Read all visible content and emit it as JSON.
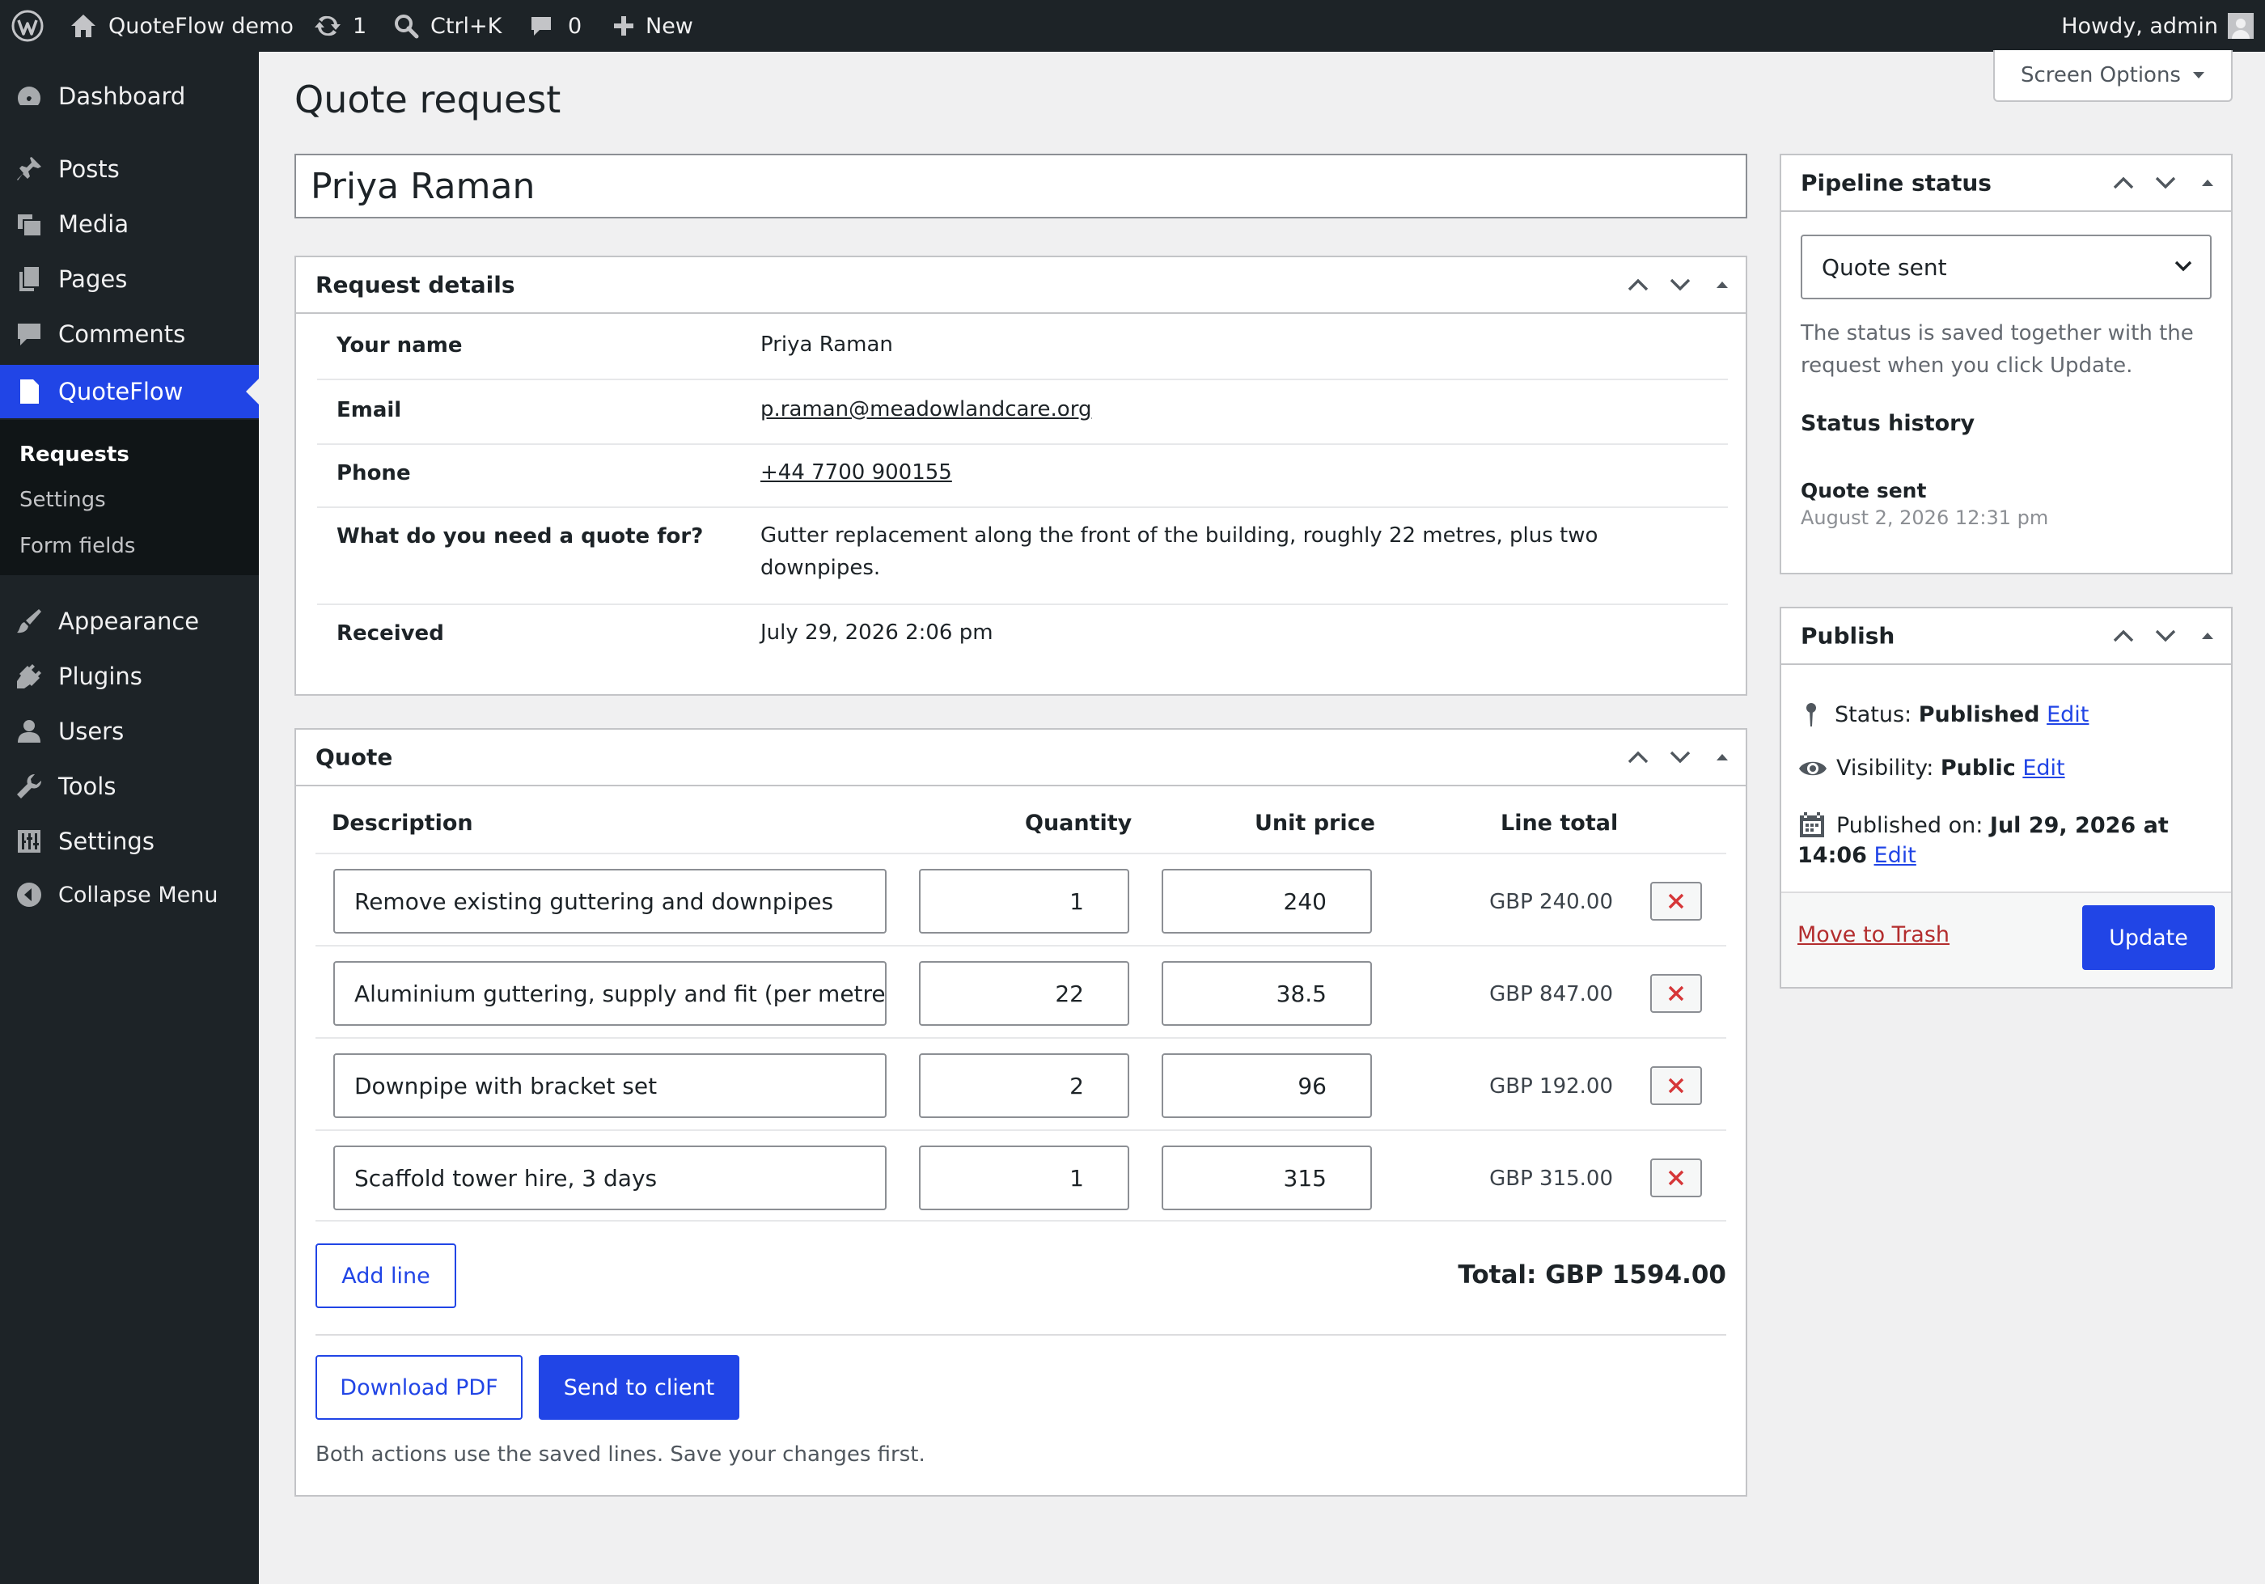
{
  "adminbar": {
    "site_name": "QuoteFlow demo",
    "updates_count": "1",
    "search_shortcut": "Ctrl+K",
    "comments_count": "0",
    "new_label": "New",
    "howdy": "Howdy, admin"
  },
  "sidebar": {
    "items": [
      {
        "label": "Dashboard",
        "icon": "dashboard-icon"
      },
      {
        "label": "Posts",
        "icon": "pin-icon"
      },
      {
        "label": "Media",
        "icon": "media-icon"
      },
      {
        "label": "Pages",
        "icon": "pages-icon"
      },
      {
        "label": "Comments",
        "icon": "comment-icon"
      },
      {
        "label": "QuoteFlow",
        "icon": "document-icon"
      },
      {
        "label": "Appearance",
        "icon": "brush-icon"
      },
      {
        "label": "Plugins",
        "icon": "plug-icon"
      },
      {
        "label": "Users",
        "icon": "user-icon"
      },
      {
        "label": "Tools",
        "icon": "wrench-icon"
      },
      {
        "label": "Settings",
        "icon": "sliders-icon"
      },
      {
        "label": "Collapse Menu",
        "icon": "collapse-icon"
      }
    ],
    "submenu": [
      "Requests",
      "Settings",
      "Form fields"
    ]
  },
  "screen_options_label": "Screen Options",
  "page_title": "Quote request",
  "post_title": "Priya Raman",
  "request_details": {
    "title": "Request details",
    "rows": [
      {
        "label": "Your name",
        "value": "Priya Raman"
      },
      {
        "label": "Email",
        "value": "p.raman@meadowlandcare.org"
      },
      {
        "label": "Phone",
        "value": "+44 7700 900155"
      },
      {
        "label": "What do you need a quote for?",
        "value": "Gutter replacement along the front of the building, roughly 22 metres, plus two downpipes."
      },
      {
        "label": "Received",
        "value": "July 29, 2026 2:06 pm"
      }
    ]
  },
  "quote": {
    "title": "Quote",
    "headers": {
      "description": "Description",
      "quantity": "Quantity",
      "unit_price": "Unit price",
      "line_total": "Line total"
    },
    "lines": [
      {
        "description": "Remove existing guttering and downpipes",
        "quantity": "1",
        "unit_price": "240",
        "line_total": "GBP 240.00"
      },
      {
        "description": "Aluminium guttering, supply and fit (per metre)",
        "quantity": "22",
        "unit_price": "38.5",
        "line_total": "GBP 847.00"
      },
      {
        "description": "Downpipe with bracket set",
        "quantity": "2",
        "unit_price": "96",
        "line_total": "GBP 192.00"
      },
      {
        "description": "Scaffold tower hire, 3 days",
        "quantity": "1",
        "unit_price": "315",
        "line_total": "GBP 315.00"
      }
    ],
    "add_line_label": "Add line",
    "total": "Total: GBP 1594.00",
    "download_pdf_label": "Download PDF",
    "send_label": "Send to client",
    "note": "Both actions use the saved lines. Save your changes first."
  },
  "pipeline": {
    "title": "Pipeline status",
    "selected": "Quote sent",
    "help": "The status is saved together with the request when you click Update.",
    "history_title": "Status history",
    "history": [
      {
        "status": "Quote sent",
        "date": "August 2, 2026 12:31 pm"
      }
    ]
  },
  "publish": {
    "title": "Publish",
    "status_label": "Status:",
    "status_value": "Published",
    "visibility_label": "Visibility:",
    "visibility_value": "Public",
    "published_label": "Published on:",
    "published_value_1": "Jul 29, 2026 at",
    "published_value_2": "14:06",
    "edit_label": "Edit",
    "trash_label": "Move to Trash",
    "update_label": "Update"
  },
  "colors": {
    "accent": "#2145e6",
    "admin_bar": "#1d2327",
    "background": "#f0f0f1",
    "delete": "#d63638",
    "trash": "#b32d2e"
  }
}
